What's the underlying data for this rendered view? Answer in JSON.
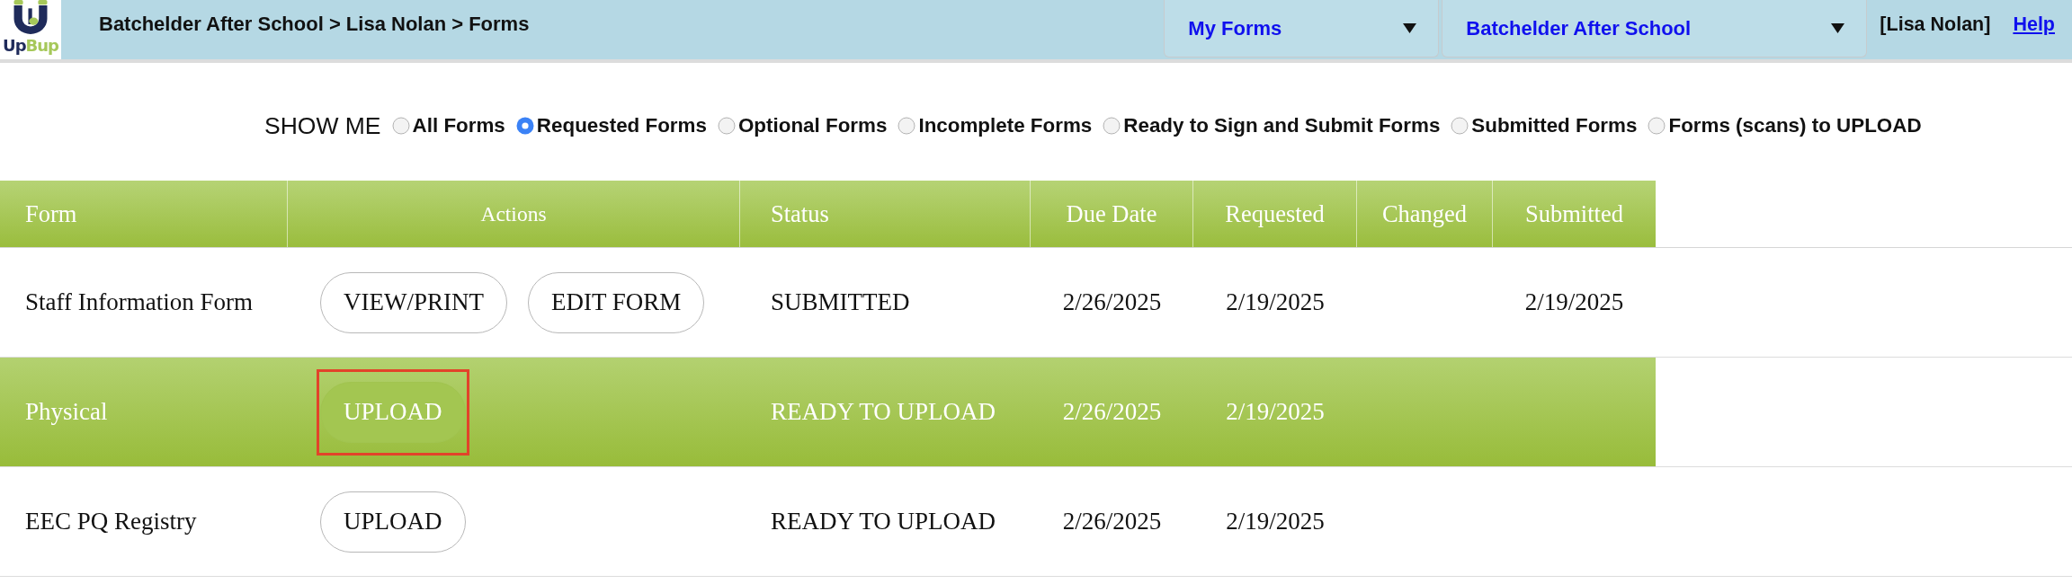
{
  "header": {
    "logo": {
      "text_parts": [
        "Up",
        "Bup"
      ]
    },
    "breadcrumb": "Batchelder After School > Lisa Nolan > Forms",
    "dropdowns": [
      {
        "value": "My Forms"
      },
      {
        "value": "Batchelder After School"
      }
    ],
    "user": "[Lisa Nolan]",
    "help_link": "Help"
  },
  "filter": {
    "label": "SHOW ME",
    "options": [
      {
        "label": "All Forms",
        "selected": false
      },
      {
        "label": "Requested Forms",
        "selected": true
      },
      {
        "label": "Optional Forms",
        "selected": false
      },
      {
        "label": "Incomplete Forms",
        "selected": false
      },
      {
        "label": "Ready to Sign and Submit Forms",
        "selected": false
      },
      {
        "label": "Submitted Forms",
        "selected": false
      },
      {
        "label": "Forms (scans) to UPLOAD",
        "selected": false
      }
    ]
  },
  "table": {
    "columns": [
      "Form",
      "Actions",
      "Status",
      "Due Date",
      "Requested",
      "Changed",
      "Submitted"
    ],
    "rows": [
      {
        "selected": false,
        "form": "Staff Information Form",
        "actions": [
          {
            "label": "VIEW/PRINT",
            "highlighted": false
          },
          {
            "label": "EDIT FORM",
            "highlighted": false
          }
        ],
        "status": "SUBMITTED",
        "due_date": "2/26/2025",
        "requested": "2/19/2025",
        "submitted": "2/19/2025"
      },
      {
        "selected": true,
        "form": "Physical",
        "actions": [
          {
            "label": "UPLOAD",
            "highlighted": true
          }
        ],
        "status": "READY TO UPLOAD",
        "due_date": "2/26/2025",
        "requested": "2/19/2025"
      },
      {
        "selected": false,
        "form": "EEC PQ Registry",
        "actions": [
          {
            "label": "UPLOAD",
            "highlighted": false
          }
        ],
        "status": "READY TO UPLOAD",
        "due_date": "2/26/2025",
        "requested": "2/19/2025"
      }
    ]
  }
}
